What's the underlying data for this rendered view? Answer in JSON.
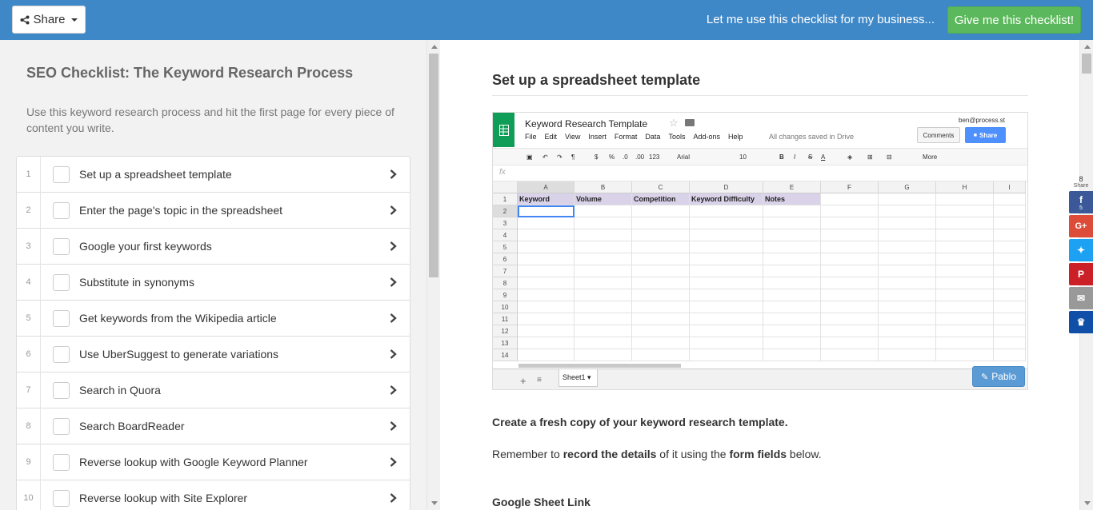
{
  "topbar": {
    "share_label": "Share",
    "business_link": "Let me use this checklist for my business...",
    "cta_label": "Give me this checklist!"
  },
  "checklist": {
    "title": "SEO Checklist: The Keyword Research Process",
    "description": "Use this keyword research process and hit the first page for every piece of content you write.",
    "tasks": [
      {
        "num": "1",
        "label": "Set up a spreadsheet template"
      },
      {
        "num": "2",
        "label": "Enter the page's topic in the spreadsheet"
      },
      {
        "num": "3",
        "label": "Google your first keywords"
      },
      {
        "num": "4",
        "label": "Substitute in synonyms"
      },
      {
        "num": "5",
        "label": "Get keywords from the Wikipedia article"
      },
      {
        "num": "6",
        "label": "Use UberSuggest to generate variations"
      },
      {
        "num": "7",
        "label": "Search in Quora"
      },
      {
        "num": "8",
        "label": "Search BoardReader"
      },
      {
        "num": "9",
        "label": "Reverse lookup with Google Keyword Planner"
      },
      {
        "num": "10",
        "label": "Reverse lookup with Site Explorer"
      }
    ]
  },
  "main": {
    "heading": "Set up a spreadsheet template",
    "sheet": {
      "title": "Keyword Research Template",
      "menu": [
        "File",
        "Edit",
        "View",
        "Insert",
        "Format",
        "Data",
        "Tools",
        "Add-ons",
        "Help"
      ],
      "saved_status": "All changes saved in Drive",
      "user": "ben@process.st",
      "comments_label": "Comments",
      "share_label": "Share",
      "toolbar": {
        "dollar": "$",
        "percent": "%",
        "dec_less": ".0",
        "dec_more": ".00",
        "num_fmt": "123",
        "font": "Arial",
        "size": "10",
        "bold": "B",
        "italic": "I",
        "strike": "S",
        "color": "A",
        "more": "More"
      },
      "fx": "fx",
      "columns": [
        "A",
        "B",
        "C",
        "D",
        "E",
        "F",
        "G",
        "H",
        "I"
      ],
      "rows": [
        "1",
        "2",
        "3",
        "4",
        "5",
        "6",
        "7",
        "8",
        "9",
        "10",
        "11",
        "12",
        "13",
        "14"
      ],
      "header_cells": [
        "Keyword",
        "Volume",
        "Competition",
        "Keyword Difficulty",
        "Notes"
      ],
      "tab_name": "Sheet1",
      "pablo_label": "Pablo"
    },
    "para1": "Create a fresh copy of your keyword research template.",
    "para2": {
      "t1": "Remember to ",
      "b1": "record the details",
      "t2": " of it using the ",
      "b2": "form fields",
      "t3": " below."
    },
    "field_label": "Google Sheet Link"
  },
  "social": {
    "total": "8",
    "total_caption": "Share",
    "facebook_count": "5",
    "colors": {
      "facebook": "#3b5998",
      "google": "#dd4b39",
      "twitter": "#1da1f2",
      "pinterest": "#cb2027",
      "email": "#999999",
      "sumome": "#0f4fa8"
    }
  }
}
